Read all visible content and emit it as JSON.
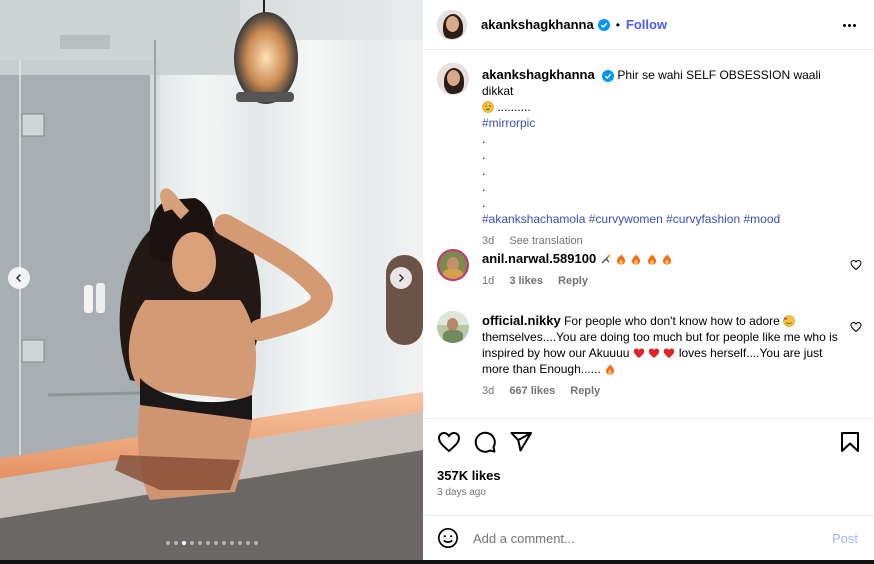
{
  "post": {
    "username": "akankshagkhanna",
    "follow_label": "Follow",
    "separator": "•",
    "caption_main": "Phir se wahi SELF OBSESSION waali dikkat",
    "caption_dots": "..........",
    "hashtag1": "#mirrorpic",
    "dot_lines": [
      ".",
      ".",
      ".",
      ".",
      "."
    ],
    "hashtag_line": "#akankshachamola #curvywomen #curvyfashion #mood",
    "caption_time": "3d",
    "see_translation": "See translation"
  },
  "comments": [
    {
      "username": "anil.narwal.589100",
      "time": "1d",
      "likes": "3 likes",
      "reply": "Reply"
    },
    {
      "username": "official.nikky",
      "text_1": "For people who don't know how to adore",
      "text_2": "themselves....You are doing too much but for people like me who is inspired by how our Akuuuu",
      "text_3": "loves herself....You are just more than Enough......",
      "time": "3d",
      "likes": "667 likes",
      "reply": "Reply"
    }
  ],
  "footer": {
    "likes": "357K likes",
    "ago": "3 days ago",
    "add_comment_placeholder": "Add a comment...",
    "post_label": "Post"
  },
  "carousel": {
    "total": 12,
    "active_index": 2
  },
  "colors": {
    "link": "#4a5df9",
    "hashtag": "#3a4db8",
    "post_disabled": "#a3b4f4",
    "verified": "#0095f6"
  },
  "icons": [
    "verified-badge-icon",
    "more-options-icon",
    "heart-icon",
    "comment-icon",
    "share-icon",
    "save-icon",
    "emoji-icon",
    "chevron-left-icon",
    "chevron-right-icon"
  ]
}
